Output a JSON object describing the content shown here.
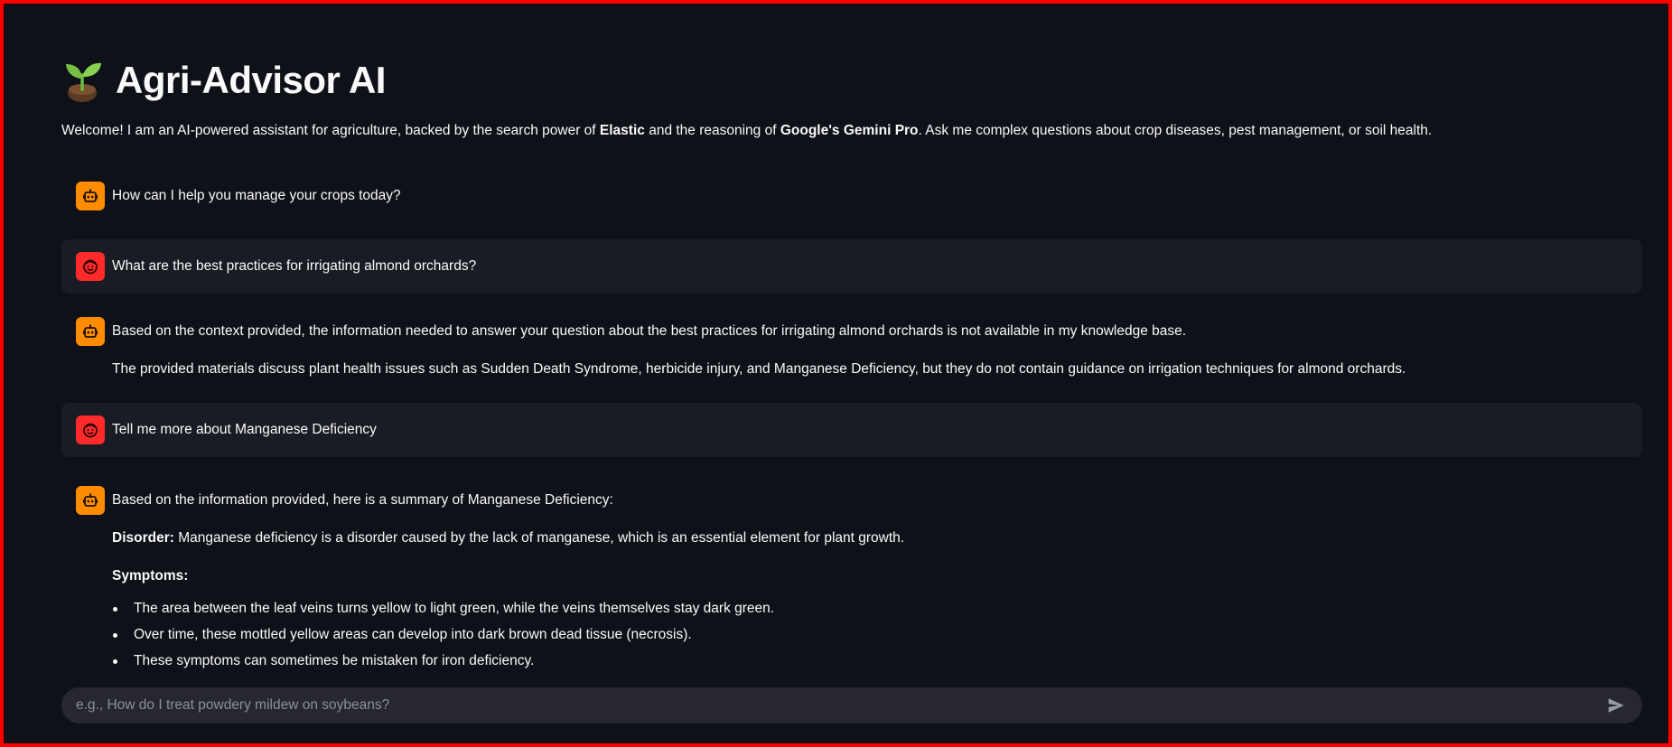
{
  "header": {
    "icon": "sprout-icon",
    "title": "Agri-Advisor AI",
    "intro_parts": [
      "Welcome! I am an AI-powered assistant for agriculture, backed by the search power of ",
      "Elastic",
      " and the reasoning of ",
      "Google's Gemini Pro",
      ". Ask me complex questions about crop diseases, pest management, or soil health."
    ]
  },
  "colors": {
    "background": "#0e1117",
    "user_bubble": "#1a1c24",
    "bot_avatar": "#ff8c00",
    "user_avatar": "#ff2b2b",
    "input_bg": "#262730",
    "frame_border": "#ff0000"
  },
  "messages": [
    {
      "role": "assistant",
      "avatar_icon": "robot-icon",
      "paragraphs": [
        "How can I help you manage your crops today?"
      ]
    },
    {
      "role": "user",
      "avatar_icon": "smiley-face-icon",
      "paragraphs": [
        "What are the best practices for irrigating almond orchards?"
      ]
    },
    {
      "role": "assistant",
      "avatar_icon": "robot-icon",
      "paragraphs": [
        "Based on the context provided, the information needed to answer your question about the best practices for irrigating almond orchards is not available in my knowledge base.",
        "The provided materials discuss plant health issues such as Sudden Death Syndrome, herbicide injury, and Manganese Deficiency, but they do not contain guidance on irrigation techniques for almond orchards."
      ]
    },
    {
      "role": "user",
      "avatar_icon": "smiley-face-icon",
      "paragraphs": [
        "Tell me more about Manganese Deficiency"
      ]
    },
    {
      "role": "assistant",
      "avatar_icon": "robot-icon",
      "intro": "Based on the information provided, here is a summary of Manganese Deficiency:",
      "disorder_label": "Disorder:",
      "disorder_text": " Manganese deficiency is a disorder caused by the lack of manganese, which is an essential element for plant growth.",
      "symptoms_label": "Symptoms:",
      "symptoms": [
        "The area between the leaf veins turns yellow to light green, while the veins themselves stay dark green.",
        "Over time, these mottled yellow areas can develop into dark brown dead tissue (necrosis).",
        "These symptoms can sometimes be mistaken for iron deficiency."
      ]
    }
  ],
  "chat_input": {
    "placeholder": "e.g., How do I treat powdery mildew on soybeans?",
    "value": "",
    "send_icon": "send-icon"
  }
}
